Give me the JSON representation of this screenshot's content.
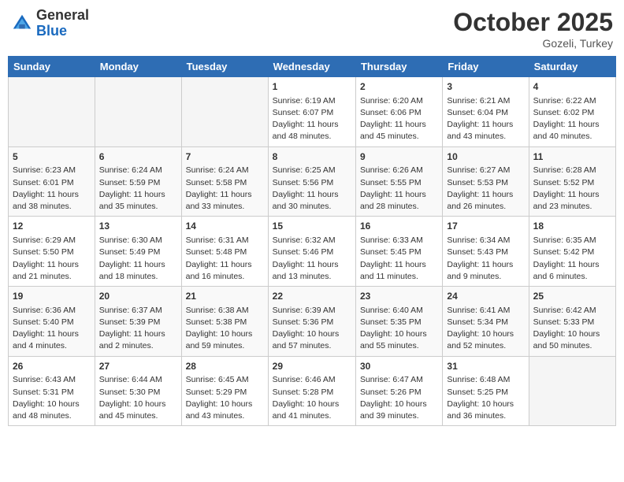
{
  "header": {
    "logo_general": "General",
    "logo_blue": "Blue",
    "month": "October 2025",
    "location": "Gozeli, Turkey"
  },
  "weekdays": [
    "Sunday",
    "Monday",
    "Tuesday",
    "Wednesday",
    "Thursday",
    "Friday",
    "Saturday"
  ],
  "weeks": [
    [
      {
        "day": "",
        "info": ""
      },
      {
        "day": "",
        "info": ""
      },
      {
        "day": "",
        "info": ""
      },
      {
        "day": "1",
        "info": "Sunrise: 6:19 AM\nSunset: 6:07 PM\nDaylight: 11 hours and 48 minutes."
      },
      {
        "day": "2",
        "info": "Sunrise: 6:20 AM\nSunset: 6:06 PM\nDaylight: 11 hours and 45 minutes."
      },
      {
        "day": "3",
        "info": "Sunrise: 6:21 AM\nSunset: 6:04 PM\nDaylight: 11 hours and 43 minutes."
      },
      {
        "day": "4",
        "info": "Sunrise: 6:22 AM\nSunset: 6:02 PM\nDaylight: 11 hours and 40 minutes."
      }
    ],
    [
      {
        "day": "5",
        "info": "Sunrise: 6:23 AM\nSunset: 6:01 PM\nDaylight: 11 hours and 38 minutes."
      },
      {
        "day": "6",
        "info": "Sunrise: 6:24 AM\nSunset: 5:59 PM\nDaylight: 11 hours and 35 minutes."
      },
      {
        "day": "7",
        "info": "Sunrise: 6:24 AM\nSunset: 5:58 PM\nDaylight: 11 hours and 33 minutes."
      },
      {
        "day": "8",
        "info": "Sunrise: 6:25 AM\nSunset: 5:56 PM\nDaylight: 11 hours and 30 minutes."
      },
      {
        "day": "9",
        "info": "Sunrise: 6:26 AM\nSunset: 5:55 PM\nDaylight: 11 hours and 28 minutes."
      },
      {
        "day": "10",
        "info": "Sunrise: 6:27 AM\nSunset: 5:53 PM\nDaylight: 11 hours and 26 minutes."
      },
      {
        "day": "11",
        "info": "Sunrise: 6:28 AM\nSunset: 5:52 PM\nDaylight: 11 hours and 23 minutes."
      }
    ],
    [
      {
        "day": "12",
        "info": "Sunrise: 6:29 AM\nSunset: 5:50 PM\nDaylight: 11 hours and 21 minutes."
      },
      {
        "day": "13",
        "info": "Sunrise: 6:30 AM\nSunset: 5:49 PM\nDaylight: 11 hours and 18 minutes."
      },
      {
        "day": "14",
        "info": "Sunrise: 6:31 AM\nSunset: 5:48 PM\nDaylight: 11 hours and 16 minutes."
      },
      {
        "day": "15",
        "info": "Sunrise: 6:32 AM\nSunset: 5:46 PM\nDaylight: 11 hours and 13 minutes."
      },
      {
        "day": "16",
        "info": "Sunrise: 6:33 AM\nSunset: 5:45 PM\nDaylight: 11 hours and 11 minutes."
      },
      {
        "day": "17",
        "info": "Sunrise: 6:34 AM\nSunset: 5:43 PM\nDaylight: 11 hours and 9 minutes."
      },
      {
        "day": "18",
        "info": "Sunrise: 6:35 AM\nSunset: 5:42 PM\nDaylight: 11 hours and 6 minutes."
      }
    ],
    [
      {
        "day": "19",
        "info": "Sunrise: 6:36 AM\nSunset: 5:40 PM\nDaylight: 11 hours and 4 minutes."
      },
      {
        "day": "20",
        "info": "Sunrise: 6:37 AM\nSunset: 5:39 PM\nDaylight: 11 hours and 2 minutes."
      },
      {
        "day": "21",
        "info": "Sunrise: 6:38 AM\nSunset: 5:38 PM\nDaylight: 10 hours and 59 minutes."
      },
      {
        "day": "22",
        "info": "Sunrise: 6:39 AM\nSunset: 5:36 PM\nDaylight: 10 hours and 57 minutes."
      },
      {
        "day": "23",
        "info": "Sunrise: 6:40 AM\nSunset: 5:35 PM\nDaylight: 10 hours and 55 minutes."
      },
      {
        "day": "24",
        "info": "Sunrise: 6:41 AM\nSunset: 5:34 PM\nDaylight: 10 hours and 52 minutes."
      },
      {
        "day": "25",
        "info": "Sunrise: 6:42 AM\nSunset: 5:33 PM\nDaylight: 10 hours and 50 minutes."
      }
    ],
    [
      {
        "day": "26",
        "info": "Sunrise: 6:43 AM\nSunset: 5:31 PM\nDaylight: 10 hours and 48 minutes."
      },
      {
        "day": "27",
        "info": "Sunrise: 6:44 AM\nSunset: 5:30 PM\nDaylight: 10 hours and 45 minutes."
      },
      {
        "day": "28",
        "info": "Sunrise: 6:45 AM\nSunset: 5:29 PM\nDaylight: 10 hours and 43 minutes."
      },
      {
        "day": "29",
        "info": "Sunrise: 6:46 AM\nSunset: 5:28 PM\nDaylight: 10 hours and 41 minutes."
      },
      {
        "day": "30",
        "info": "Sunrise: 6:47 AM\nSunset: 5:26 PM\nDaylight: 10 hours and 39 minutes."
      },
      {
        "day": "31",
        "info": "Sunrise: 6:48 AM\nSunset: 5:25 PM\nDaylight: 10 hours and 36 minutes."
      },
      {
        "day": "",
        "info": ""
      }
    ]
  ]
}
